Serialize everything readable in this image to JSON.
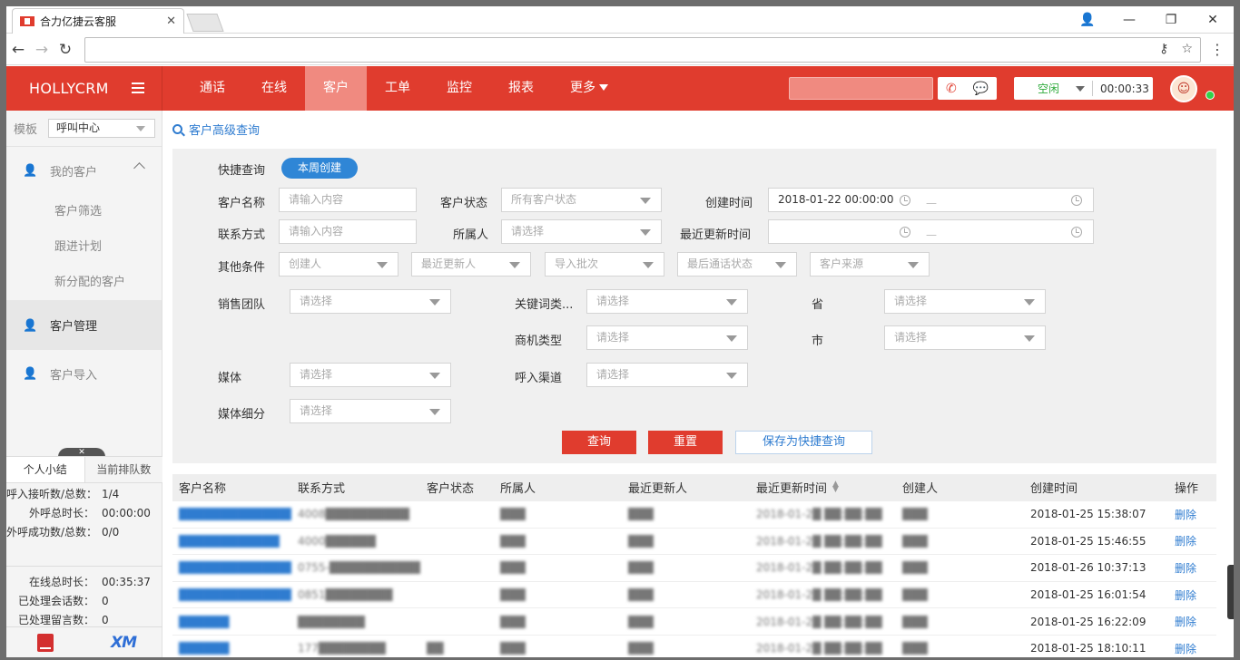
{
  "browser": {
    "tab_title": "合力亿捷云客服",
    "close_glyph": "✕",
    "window_controls": [
      "👤",
      "—",
      "❐",
      "✕"
    ]
  },
  "header": {
    "brand": "HOLLYCRM",
    "nav": [
      {
        "label": "通话"
      },
      {
        "label": "在线"
      },
      {
        "label": "客户",
        "active": true
      },
      {
        "label": "工单"
      },
      {
        "label": "监控"
      },
      {
        "label": "报表"
      },
      {
        "label": "更多"
      }
    ],
    "status": "空闲",
    "timer": "00:00:33"
  },
  "sidebar": {
    "template_label": "模板",
    "template_value": "呼叫中心",
    "groups": {
      "my_customers": "我的客户",
      "sub": [
        "客户筛选",
        "跟进计划",
        "新分配的客户"
      ],
      "manage": "客户管理",
      "import": "客户导入"
    },
    "summary_tabs": [
      "个人小结",
      "当前排队数"
    ],
    "summary": [
      {
        "k": "呼入接听数/总数：",
        "v": "1/4"
      },
      {
        "k": "外呼总时长：",
        "v": "00:00:00"
      },
      {
        "k": "外呼成功数/总数：",
        "v": "0/0"
      }
    ],
    "summary2": [
      {
        "k": "在线总时长：",
        "v": "00:35:37"
      },
      {
        "k": "已处理会话数：",
        "v": "0"
      },
      {
        "k": "已处理留言数：",
        "v": "0"
      }
    ],
    "footer_xm": "XM"
  },
  "content": {
    "breadcrumb": "客户高级查询",
    "quick_label": "快捷查询",
    "quick_chip": "本周创建",
    "fields": {
      "name_label": "客户名称",
      "name_ph": "请输入内容",
      "status_label": "客户状态",
      "status_ph": "所有客户状态",
      "created_label": "创建时间",
      "created_val": "2018-01-22 00:00:00",
      "contact_label": "联系方式",
      "contact_ph": "请输入内容",
      "owner_label": "所属人",
      "owner_ph": "请选择",
      "updated_label": "最近更新时间",
      "other_label": "其他条件",
      "other": [
        "创建人",
        "最近更新人",
        "导入批次",
        "最后通话状态",
        "客户来源"
      ],
      "team_label": "销售团队",
      "keyword_label": "关键词类...",
      "province_label": "省",
      "biz_label": "商机类型",
      "city_label": "市",
      "media_label": "媒体",
      "channel_label": "呼入渠道",
      "media_sub_label": "媒体细分",
      "select_ph": "请选择",
      "range_sep": "—"
    },
    "buttons": {
      "query": "查询",
      "reset": "重置",
      "save": "保存为快捷查询"
    }
  },
  "table": {
    "columns": [
      "客户名称",
      "联系方式",
      "客户状态",
      "所属人",
      "最近更新人",
      "最近更新时间",
      "创建人",
      "创建时间",
      "操作"
    ],
    "rows": [
      {
        "name": "██████████████",
        "contact": "4008██████████",
        "status": "",
        "owner": "███",
        "updater": "███",
        "updated": "2018-01-2█ ██:██:██",
        "creator": "███",
        "created": "2018-01-25 15:38:07",
        "op": "删除"
      },
      {
        "name": "████████████",
        "contact": "4000██████",
        "status": "",
        "owner": "███",
        "updater": "███",
        "updated": "2018-01-2█ ██:██:██",
        "creator": "███",
        "created": "2018-01-25 15:46:55",
        "op": "删除"
      },
      {
        "name": "██████████████",
        "contact": "0755-████████████",
        "status": "",
        "owner": "███",
        "updater": "███",
        "updated": "2018-01-2█ ██:██:██",
        "creator": "███",
        "created": "2018-01-26 10:37:13",
        "op": "删除"
      },
      {
        "name": "██████████████",
        "contact": "0851████████",
        "status": "",
        "owner": "███",
        "updater": "███",
        "updated": "2018-01-2█ ██:██:██",
        "creator": "███",
        "created": "2018-01-25 16:01:54",
        "op": "删除"
      },
      {
        "name": "██████",
        "contact": "████████",
        "status": "",
        "owner": "███",
        "updater": "███",
        "updated": "2018-01-2█ ██:██:██",
        "creator": "███",
        "created": "2018-01-25 16:22:09",
        "op": "删除"
      },
      {
        "name": "██████",
        "contact": "177████████",
        "status": "██",
        "owner": "███",
        "updater": "███",
        "updated": "2018-01-2█ ██:██:██",
        "creator": "███",
        "created": "2018-01-25 18:10:11",
        "op": "删除"
      }
    ]
  }
}
